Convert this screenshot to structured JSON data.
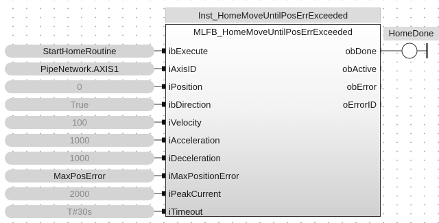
{
  "instance_name": "Inst_HomeMoveUntilPosErrExceeded",
  "function_block": {
    "type_name": "MLFB_HomeMoveUntilPosErrExceeded",
    "inputs": [
      {
        "pin": "ibExecute",
        "value": "StartHomeRoutine",
        "is_default": false
      },
      {
        "pin": "iAxisID",
        "value": "PipeNetwork.AXIS1",
        "is_default": false
      },
      {
        "pin": "iPosition",
        "value": "0",
        "is_default": true
      },
      {
        "pin": "ibDirection",
        "value": "True",
        "is_default": true
      },
      {
        "pin": "iVelocity",
        "value": "100",
        "is_default": true
      },
      {
        "pin": "iAcceleration",
        "value": "1000",
        "is_default": true
      },
      {
        "pin": "iDeceleration",
        "value": "1000",
        "is_default": true
      },
      {
        "pin": "iMaxPositionError",
        "value": "MaxPosError",
        "is_default": false
      },
      {
        "pin": "iPeakCurrent",
        "value": "2000",
        "is_default": true
      },
      {
        "pin": "iTimeout",
        "value": "T#30s",
        "is_default": true
      }
    ],
    "outputs": [
      {
        "pin": "obDone",
        "connected": true
      },
      {
        "pin": "obActive",
        "connected": false
      },
      {
        "pin": "obError",
        "connected": false
      },
      {
        "pin": "oErrorID",
        "connected": false
      }
    ]
  },
  "coil": {
    "label": "HomeDone"
  },
  "colors": {
    "wire": "#333333",
    "input_pill_bg": "#d4d4d4",
    "default_value_text": "#8a8a8a",
    "header_bg": "#dcdcdc"
  }
}
